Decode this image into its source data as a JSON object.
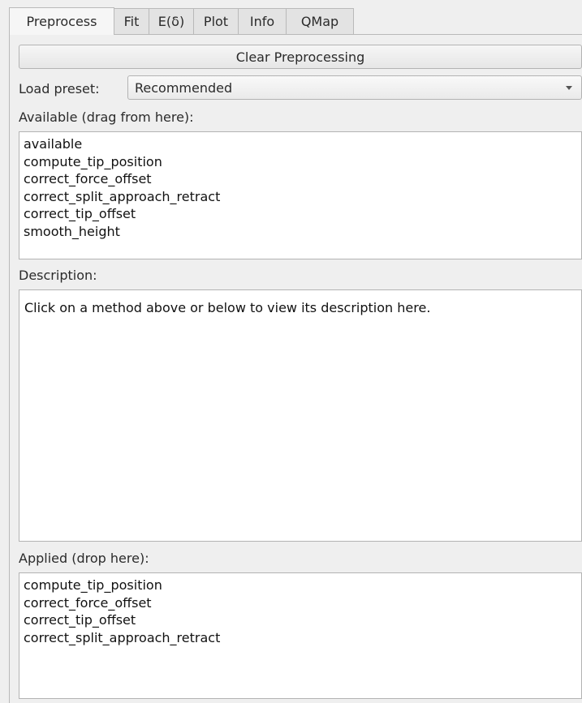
{
  "tabs": [
    {
      "label": "Preprocess",
      "active": true
    },
    {
      "label": "Fit",
      "active": false
    },
    {
      "label": "E(δ)",
      "active": false
    },
    {
      "label": "Plot",
      "active": false
    },
    {
      "label": "Info",
      "active": false
    },
    {
      "label": "QMap",
      "active": false
    }
  ],
  "clear_button": "Clear Preprocessing",
  "preset": {
    "label": "Load preset:",
    "selected": "Recommended"
  },
  "available": {
    "label": "Available (drag from here):",
    "items": [
      "available",
      "compute_tip_position",
      "correct_force_offset",
      "correct_split_approach_retract",
      "correct_tip_offset",
      "smooth_height"
    ]
  },
  "description": {
    "label": "Description:",
    "text": "Click on a method above or below to view its description here."
  },
  "applied": {
    "label": "Applied (drop here):",
    "items": [
      "compute_tip_position",
      "correct_force_offset",
      "correct_tip_offset",
      "correct_split_approach_retract"
    ]
  }
}
